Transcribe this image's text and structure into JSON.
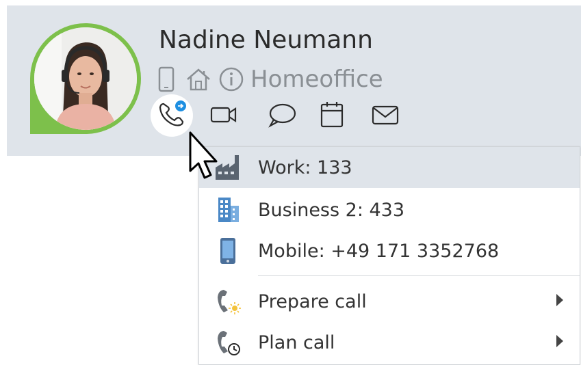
{
  "contact": {
    "name": "Nadine Neumann",
    "status": "Homeoffice",
    "presence_color": "#7dc04b"
  },
  "status_icons": [
    "mobile-device-icon",
    "home-icon",
    "info-icon"
  ],
  "actions": [
    "phone-call-icon",
    "video-call-icon",
    "chat-icon",
    "calendar-icon",
    "mail-icon"
  ],
  "menu": {
    "numbers": [
      {
        "label": "Work: 133",
        "icon": "factory-icon",
        "highlighted": true
      },
      {
        "label": "Business 2: 433",
        "icon": "office-building-icon"
      },
      {
        "label": "Mobile: +49 171 3352768",
        "icon": "mobile-phone-icon"
      }
    ],
    "options": [
      {
        "label": "Prepare call",
        "icon": "prepare-call-icon",
        "submenu": true
      },
      {
        "label": "Plan call",
        "icon": "plan-call-icon",
        "submenu": true
      }
    ]
  },
  "colors": {
    "card_bg": "#dfe4ea",
    "accent_blue": "#1e8fe1",
    "highlight": "#dfe4ea"
  }
}
